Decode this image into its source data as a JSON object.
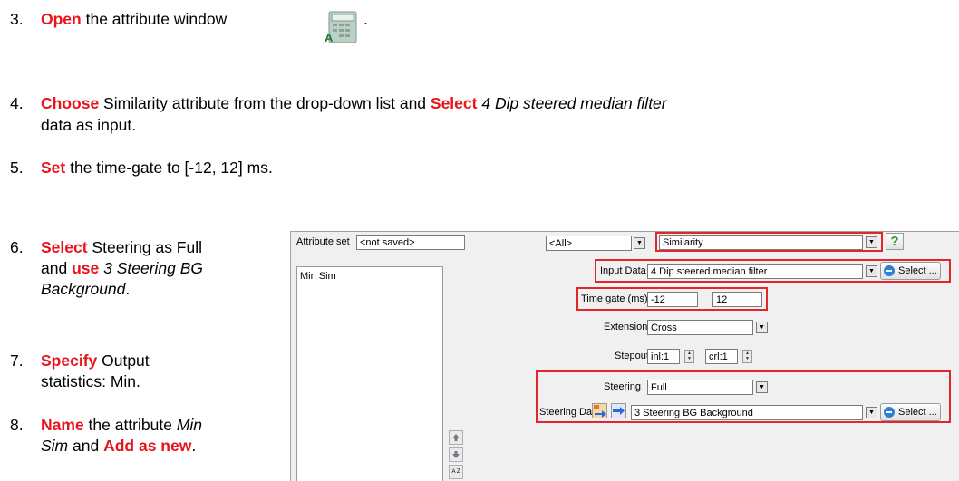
{
  "steps": {
    "s3": {
      "num": "3.",
      "kw1": "Open",
      "t1": " the attribute window",
      "t2": "."
    },
    "s4": {
      "num": "4.",
      "kw1": "Choose",
      "t1": " Similarity attribute from the drop-down list and ",
      "kw2": "Select",
      "t2": " ",
      "it1": "4 Dip steered median filter",
      "line2": "data as input."
    },
    "s5": {
      "num": "5.",
      "kw1": "Set",
      "t1": " the time-gate to [-12, 12] ms."
    },
    "s6": {
      "num": "6.",
      "kw1": "Select",
      "t1": " Steering as Full",
      "line2a": "and ",
      "kw2": "use",
      "line2b": " ",
      "it1": "3 Steering BG",
      "it2": "Background",
      "line3end": "."
    },
    "s7": {
      "num": "7.",
      "kw1": "Specify",
      "t1": " Output",
      "line2": "statistics: Min."
    },
    "s8": {
      "num": "8.",
      "kw1": "Name",
      "t1": " the attribute ",
      "it1": "Min",
      "it2": "Sim",
      "line3a": " and ",
      "kw2": "Add as new",
      "line3end": "."
    }
  },
  "dialog": {
    "attribute_set_label": "Attribute set",
    "attribute_set_value": "<not saved>",
    "attributes_list": [
      "Min Sim"
    ],
    "filter_value": "<All>",
    "attribute_type": "Similarity",
    "help_label": "?",
    "input_data_label": "Input Data",
    "input_data_value": "4 Dip steered median filter",
    "select_label": "Select ...",
    "time_gate_label": "Time gate (ms)",
    "time_gate_start": "-12",
    "time_gate_end": "12",
    "extension_label": "Extension",
    "extension_value": "Cross",
    "stepout_label": "Stepout",
    "stepout_inl": "inl:1",
    "stepout_crl": "crl:1",
    "steering_label": "Steering",
    "steering_value": "Full",
    "steering_data_label": "Steering Data",
    "steering_data_value": "3 Steering BG Background",
    "select_label2": "Select ...",
    "sort_label": "A Z"
  },
  "colors": {
    "keyword": "#e8141c",
    "highlight_box": "#e3262b",
    "dialog_bg": "#f0f0f0"
  },
  "icons": [
    "calculator-icon",
    "dropdown-arrow-icon",
    "help-icon",
    "select-icon",
    "spin-up-icon",
    "spin-down-icon",
    "steering-from-input-icon",
    "steering-arrow-icon",
    "move-up-icon",
    "move-down-icon",
    "sort-icon"
  ]
}
